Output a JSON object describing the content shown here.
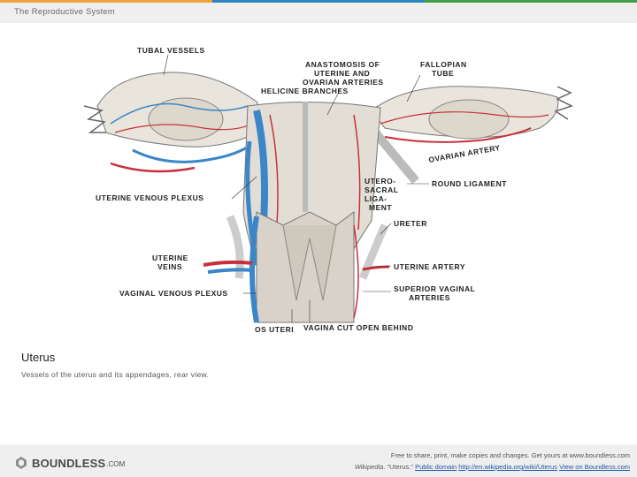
{
  "header": {
    "title": "The Reproductive System"
  },
  "colors": {
    "accent_orange": "#f0a33a",
    "accent_blue": "#2e86c1",
    "accent_green": "#43a047",
    "vein": "#3a86c8",
    "artery": "#c8303a"
  },
  "figure": {
    "labels": {
      "tubal_vessels": "TUBAL VESSELS",
      "anastomosis_1": "ANASTOMOSIS OF",
      "anastomosis_2": "UTERINE AND",
      "anastomosis_3": "OVARIAN ARTERIES",
      "helicine": "HELICINE BRANCHES",
      "fallopian_1": "FALLOPIAN",
      "fallopian_2": "TUBE",
      "ovarian_artery": "OVARIAN ARTERY",
      "uterine_venous_plexus": "UTERINE VENOUS PLEXUS",
      "utero_1": "UTERO-",
      "utero_2": "SACRAL",
      "utero_3": "LIGA-",
      "utero_4": "MENT",
      "round_ligament": "ROUND LIGAMENT",
      "ureter": "URETER",
      "uterine_veins_1": "UTERINE",
      "uterine_veins_2": "VEINS",
      "uterine_artery": "UTERINE ARTERY",
      "vaginal_venous_plexus": "VAGINAL VENOUS PLEXUS",
      "superior_vaginal_1": "SUPERIOR VAGINAL",
      "superior_vaginal_2": "ARTERIES",
      "os_uteri": "OS UTERI",
      "vagina_cut": "VAGINA CUT OPEN BEHIND"
    }
  },
  "caption": {
    "title": "Uterus",
    "text": "Vessels of the uterus and its appendages, rear view."
  },
  "footer": {
    "logo_word": "BOUNDLESS",
    "logo_suffix": ".COM",
    "line1": "Free to share, print, make copies and changes. Get yours at www.boundless.com",
    "source_prefix": "Wikipedia",
    "source_title": ". \"Uterus.\"",
    "license": "Public domain",
    "url": "http://en.wikipedia.org/wiki/Uterus",
    "view_link": "View on Boundless.com"
  }
}
